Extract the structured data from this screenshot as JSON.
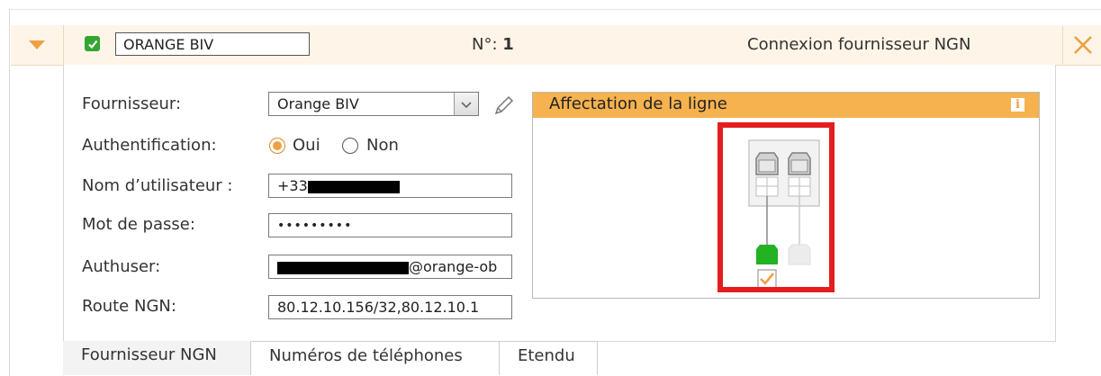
{
  "header": {
    "checked": true,
    "name_value": "ORANGE BIV",
    "number_label": "N°:",
    "number_value": "1",
    "title": "Connexion fournisseur NGN"
  },
  "form": {
    "fournisseur": {
      "label": "Fournisseur:",
      "value": "Orange BIV"
    },
    "auth": {
      "label": "Authentification:",
      "option_yes": "Oui",
      "option_no": "Non",
      "selected": "Oui"
    },
    "username": {
      "label": "Nom d’utilisateur :",
      "value": "+33"
    },
    "password": {
      "label": "Mot de passe:",
      "value": "•••••••••"
    },
    "authuser": {
      "label": "Authuser:",
      "value": "@orange-ob"
    },
    "route": {
      "label": "Route NGN:",
      "value": "80.12.10.156/32,80.12.10.1"
    }
  },
  "affectation": {
    "title": "Affectation de la ligne",
    "info_icon": "i",
    "line1_active": true,
    "line1_checked": true,
    "line2_active": false
  },
  "tabs": [
    {
      "label": "Fournisseur NGN"
    },
    {
      "label": "Numéros de téléphones"
    },
    {
      "label": "Etendu"
    }
  ],
  "colors": {
    "accent": "#f0a040",
    "header_bg": "#fef5e8",
    "check_green": "#35a532",
    "highlight_red": "#e21e1e"
  }
}
